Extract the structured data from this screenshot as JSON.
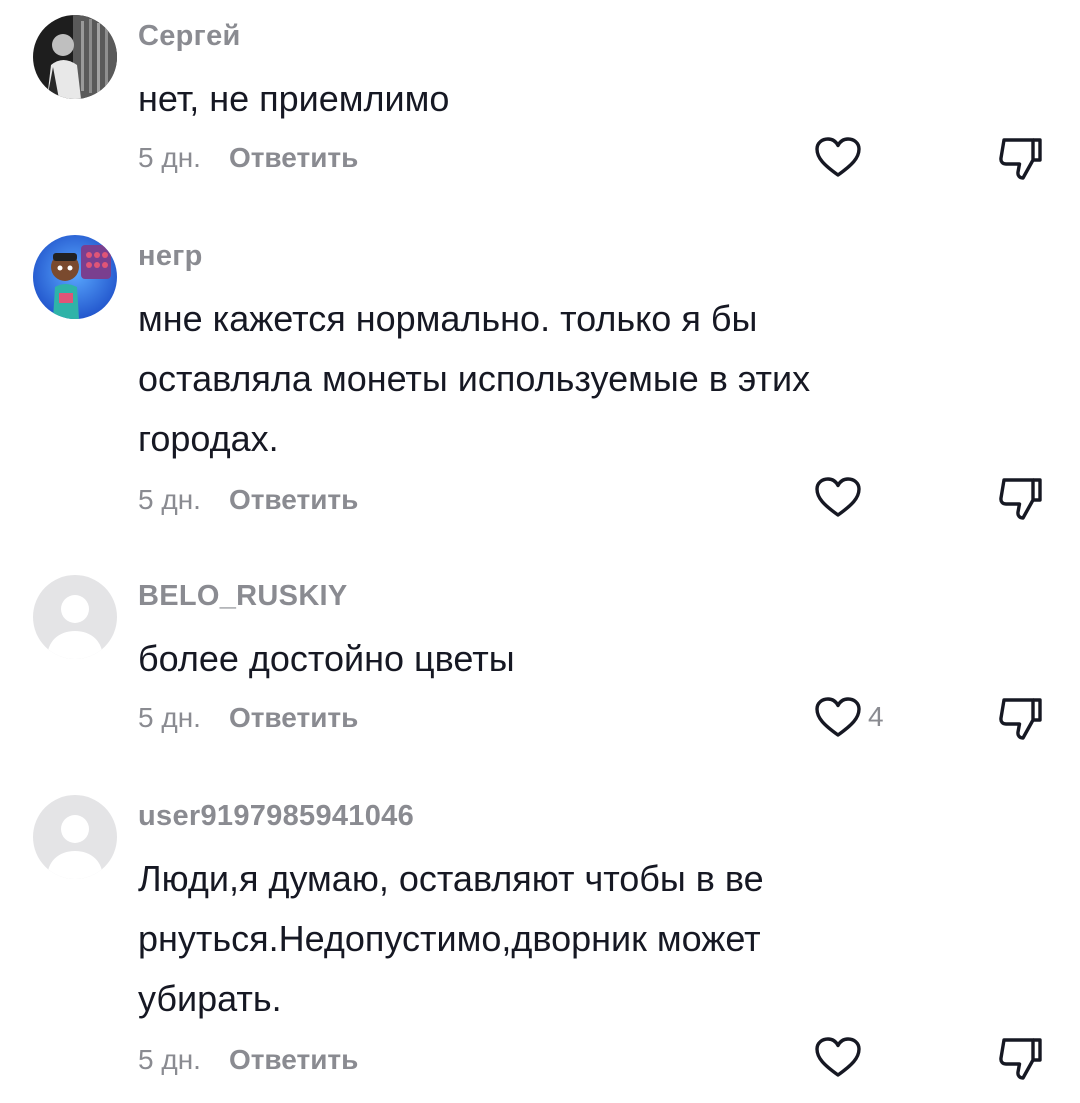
{
  "icons": {
    "like": "heart-outline-icon",
    "dislike": "thumbs-down-outline-icon",
    "default_avatar": "user-silhouette-icon"
  },
  "colors": {
    "text": "#161823",
    "secondary": "#8a8b91",
    "placeholder_avatar_bg": "#e4e4e6",
    "placeholder_avatar_fg": "#ffffff"
  },
  "comments": [
    {
      "username": "Сергей",
      "text": "нет, не приемлимо",
      "time": "5 дн.",
      "reply_label": "Ответить",
      "likes": "",
      "avatar": "photo"
    },
    {
      "username": "негр",
      "text": "мне кажется нормально. только я бы\nоставляла монеты используемые в этих\nгородах.",
      "time": "5 дн.",
      "reply_label": "Ответить",
      "likes": "",
      "avatar": "game-character"
    },
    {
      "username": "BELO_RUSKIY",
      "text": "более достойно цветы",
      "time": "5 дн.",
      "reply_label": "Ответить",
      "likes": "4",
      "avatar": "default"
    },
    {
      "username": "user9197985941046",
      "text": "Люди,я думаю, оставляют чтобы в ве\nрнуться.Недопустимо,дворник может\nубирать.",
      "time": "5 дн.",
      "reply_label": "Ответить",
      "likes": "",
      "avatar": "default"
    }
  ]
}
